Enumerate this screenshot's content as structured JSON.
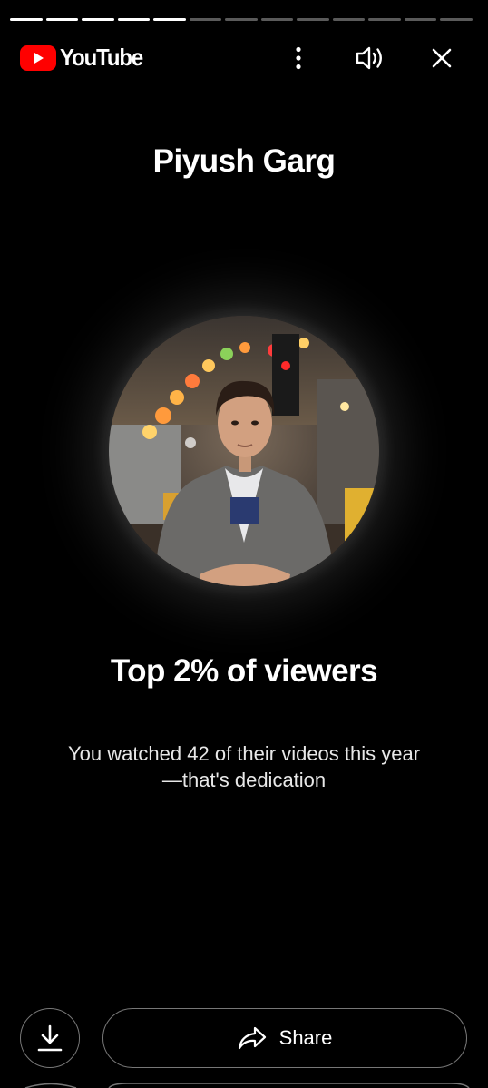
{
  "story": {
    "segments_total": 13,
    "segments_completed": 5
  },
  "header": {
    "logo_text": "YouTube",
    "logo_icon": "youtube-play-icon",
    "more_icon": "more-vertical-icon",
    "sound_icon": "volume-icon",
    "close_icon": "close-icon"
  },
  "content": {
    "creator_name": "Piyush Garg",
    "rank_title": "Top 2% of viewers",
    "message_line1": "You watched 42 of their videos this year",
    "message_line2": "—that's dedication"
  },
  "footer": {
    "download_icon": "download-icon",
    "share_icon": "share-arrow-icon",
    "share_label": "Share"
  },
  "colors": {
    "background": "#000000",
    "youtube_red": "#ff0000",
    "text": "#ffffff",
    "button_border": "#777777"
  }
}
